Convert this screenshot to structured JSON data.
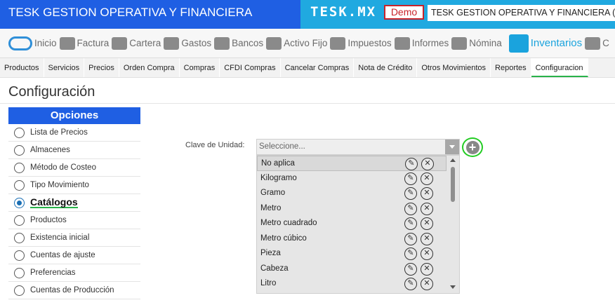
{
  "topbar": {
    "title": "TESK GESTION OPERATIVA Y FINANCIERA",
    "brand": "TESK.MX",
    "demo_label": "Demo",
    "company_value": "TESK GESTION OPERATIVA Y FINANCIERA (I"
  },
  "modules": [
    {
      "label": "Inicio",
      "icon": "cloud-icon"
    },
    {
      "label": "Factura",
      "icon": "tag-icon"
    },
    {
      "label": "Cartera",
      "icon": "wallet-icon"
    },
    {
      "label": "Gastos",
      "icon": "cart-icon"
    },
    {
      "label": "Bancos",
      "icon": "safe-icon"
    },
    {
      "label": "Activo Fijo",
      "icon": "house-icon"
    },
    {
      "label": "Impuestos",
      "icon": "briefcase-icon"
    },
    {
      "label": "Informes",
      "icon": "document-icon"
    },
    {
      "label": "Nómina",
      "icon": "card-icon"
    },
    {
      "label": "Inventarios",
      "icon": "box-icon",
      "active": true
    },
    {
      "label": "C",
      "icon": "checklist-icon"
    }
  ],
  "submenu": [
    "Productos",
    "Servicios",
    "Precios",
    "Orden Compra",
    "Compras",
    "CFDI Compras",
    "Cancelar Compras",
    "Nota de Crédito",
    "Otros Movimientos",
    "Reportes",
    "Configuracion"
  ],
  "page": {
    "title": "Configuración"
  },
  "options": {
    "header": "Opciones",
    "items": [
      "Lista de Precios",
      "Almacenes",
      "Método de Costeo",
      "Tipo Movimiento",
      "Catálogos",
      "Productos",
      "Existencia inicial",
      "Cuentas de ajuste",
      "Preferencias",
      "Cuentas de Producción"
    ],
    "selected": "Catálogos"
  },
  "form": {
    "label": "Clave de Unidad:",
    "placeholder": "Seleccione...",
    "add_button": "+",
    "list_items": [
      "No aplica",
      "Kilogramo",
      "Gramo",
      "Metro",
      "Metro cuadrado",
      "Metro cúbico",
      "Pieza",
      "Cabeza",
      "Litro"
    ],
    "edit_glyph": "✎",
    "delete_glyph": "✕"
  },
  "colors": {
    "brand_blue": "#1f5fe3",
    "accent_cyan": "#20a9e0",
    "green": "#23cc23"
  }
}
